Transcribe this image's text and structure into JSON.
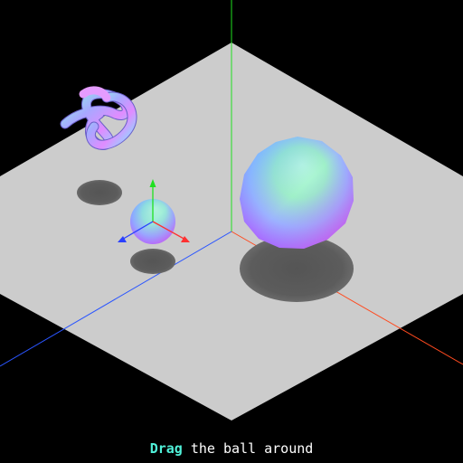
{
  "scene": {
    "background_color": "#000000",
    "ground_color": "#cccccc",
    "shadow_color": "#595959",
    "axes": {
      "x_color": "#ff4a1f",
      "y_color": "#20e020",
      "z_color": "#2a55ff"
    },
    "objects": [
      {
        "name": "large-sphere",
        "kind": "sphere",
        "material": "normal"
      },
      {
        "name": "draggable-ball",
        "kind": "sphere",
        "material": "normal"
      },
      {
        "name": "torus-knot",
        "kind": "torus-knot",
        "material": "normal"
      }
    ]
  },
  "info": {
    "highlight": "Drag",
    "text": " the ball around",
    "highlight_color": "#50f0d8"
  }
}
